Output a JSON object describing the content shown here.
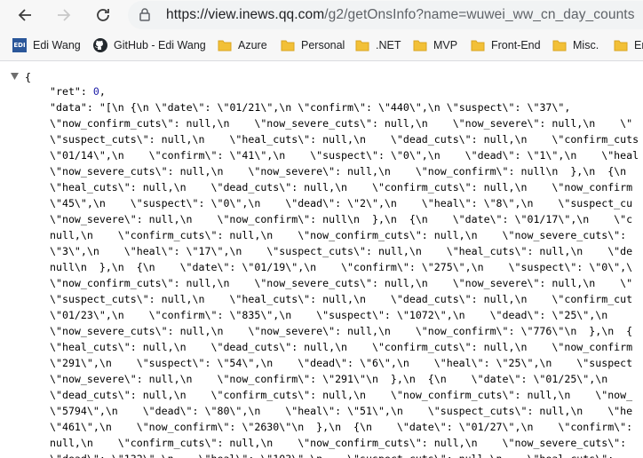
{
  "browser": {
    "url_host": "https://view.inews.qq.com",
    "url_path": "/g2/getOnsInfo?name=wuwei_ww_cn_day_counts"
  },
  "bookmarks": [
    {
      "label": "Edi Wang",
      "icon": "edi-logo-icon",
      "logo_text": "EDI"
    },
    {
      "label": "GitHub - Edi Wang",
      "icon": "github-icon"
    },
    {
      "label": "Azure",
      "icon": "folder-icon"
    },
    {
      "label": "Personal",
      "icon": "folder-icon"
    },
    {
      "label": ".NET",
      "icon": "folder-icon"
    },
    {
      "label": "MVP",
      "icon": "folder-icon"
    },
    {
      "label": "Front-End",
      "icon": "folder-icon"
    },
    {
      "label": "Misc.",
      "icon": "folder-icon"
    },
    {
      "label": "Er",
      "icon": "folder-icon"
    }
  ],
  "json": {
    "open_brace": "{",
    "ret_key": "\"ret\"",
    "ret_value": "0",
    "data_key": "\"data\"",
    "data_lines": [
      "\"[\\n  {\\n    \\\"date\\\": \\\"01/21\\\",\\n    \\\"confirm\\\": \\\"440\\\",\\n    \\\"suspect\\\": \\\"37\\\",",
      "\\\"now_confirm_cuts\\\": null,\\n    \\\"now_severe_cuts\\\": null,\\n    \\\"now_severe\\\": null,\\n    \\\"",
      "\\\"suspect_cuts\\\": null,\\n    \\\"heal_cuts\\\": null,\\n    \\\"dead_cuts\\\": null,\\n    \\\"confirm_cuts",
      "\\\"01/14\\\",\\n    \\\"confirm\\\": \\\"41\\\",\\n    \\\"suspect\\\": \\\"0\\\",\\n    \\\"dead\\\": \\\"1\\\",\\n    \\\"heal",
      "\\\"now_severe_cuts\\\": null,\\n    \\\"now_severe\\\": null,\\n    \\\"now_confirm\\\": null\\n  },\\n  {\\n",
      "\\\"heal_cuts\\\": null,\\n    \\\"dead_cuts\\\": null,\\n    \\\"confirm_cuts\\\": null,\\n    \\\"now_confirm",
      "\\\"45\\\",\\n    \\\"suspect\\\": \\\"0\\\",\\n    \\\"dead\\\": \\\"2\\\",\\n    \\\"heal\\\": \\\"8\\\",\\n    \\\"suspect_cu",
      "\\\"now_severe\\\": null,\\n    \\\"now_confirm\\\": null\\n  },\\n  {\\n    \\\"date\\\": \\\"01/17\\\",\\n    \\\"c",
      "null,\\n    \\\"confirm_cuts\\\": null,\\n    \\\"now_confirm_cuts\\\": null,\\n    \\\"now_severe_cuts\\\":",
      "\\\"3\\\",\\n    \\\"heal\\\": \\\"17\\\",\\n    \\\"suspect_cuts\\\": null,\\n    \\\"heal_cuts\\\": null,\\n    \\\"de",
      "null\\n  },\\n  {\\n    \\\"date\\\": \\\"01/19\\\",\\n    \\\"confirm\\\": \\\"275\\\",\\n    \\\"suspect\\\": \\\"0\\\",\\",
      "\\\"now_confirm_cuts\\\": null,\\n    \\\"now_severe_cuts\\\": null,\\n    \\\"now_severe\\\": null,\\n    \\\"",
      "\\\"suspect_cuts\\\": null,\\n    \\\"heal_cuts\\\": null,\\n    \\\"dead_cuts\\\": null,\\n    \\\"confirm_cut",
      "\\\"01/23\\\",\\n    \\\"confirm\\\": \\\"835\\\",\\n    \\\"suspect\\\": \\\"1072\\\",\\n    \\\"dead\\\": \\\"25\\\",\\n",
      "\\\"now_severe_cuts\\\": null,\\n    \\\"now_severe\\\": null,\\n    \\\"now_confirm\\\": \\\"776\\\"\\n  },\\n  {",
      "\\\"heal_cuts\\\": null,\\n    \\\"dead_cuts\\\": null,\\n    \\\"confirm_cuts\\\": null,\\n    \\\"now_confirm",
      "\\\"291\\\",\\n    \\\"suspect\\\": \\\"54\\\",\\n    \\\"dead\\\": \\\"6\\\",\\n    \\\"heal\\\": \\\"25\\\",\\n    \\\"suspect",
      "\\\"now_severe\\\": null,\\n    \\\"now_confirm\\\": \\\"291\\\"\\n  },\\n  {\\n    \\\"date\\\": \\\"01/25\\\",\\n",
      "\\\"dead_cuts\\\": null,\\n    \\\"confirm_cuts\\\": null,\\n    \\\"now_confirm_cuts\\\": null,\\n    \\\"now_",
      "\\\"5794\\\",\\n    \\\"dead\\\": \\\"80\\\",\\n    \\\"heal\\\": \\\"51\\\",\\n    \\\"suspect_cuts\\\": null,\\n    \\\"he",
      "\\\"461\\\",\\n    \\\"now_confirm\\\": \\\"2630\\\"\\n  },\\n  {\\n    \\\"date\\\": \\\"01/27\\\",\\n    \\\"confirm\\\":",
      "null,\\n    \\\"confirm_cuts\\\": null,\\n    \\\"now_confirm_cuts\\\": null,\\n    \\\"now_severe_cuts\\\":",
      "\\\"dead\\\": \\\"132\\\",\\n    \\\"heal\\\": \\\"103\\\",\\n    \\\"suspect_cuts\\\": null,\\n    \\\"heal_cuts\\\":"
    ]
  }
}
